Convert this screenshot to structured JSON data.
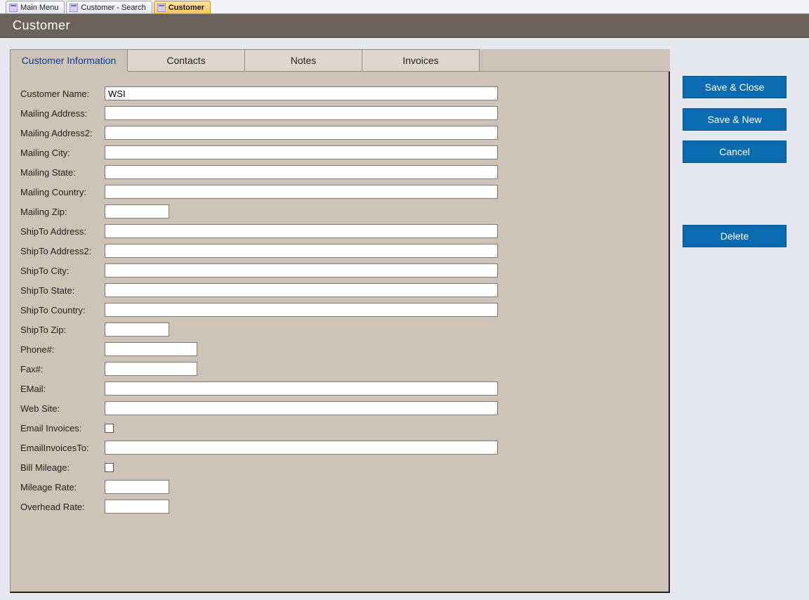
{
  "file_tabs": [
    {
      "label": "Main Menu",
      "active": false
    },
    {
      "label": "Customer - Search",
      "active": false
    },
    {
      "label": "Customer",
      "active": true
    }
  ],
  "header": {
    "title": "Customer"
  },
  "sub_tabs": [
    {
      "label": "Customer Information",
      "active": true
    },
    {
      "label": "Contacts",
      "active": false
    },
    {
      "label": "Notes",
      "active": false
    },
    {
      "label": "Invoices",
      "active": false
    }
  ],
  "form": {
    "customer_name": {
      "label": "Customer Name:",
      "value": "WSI"
    },
    "mailing_address": {
      "label": "Mailing Address:",
      "value": ""
    },
    "mailing_address2": {
      "label": "Mailing Address2:",
      "value": ""
    },
    "mailing_city": {
      "label": "Mailing City:",
      "value": ""
    },
    "mailing_state": {
      "label": "Mailing State:",
      "value": ""
    },
    "mailing_country": {
      "label": "Mailing Country:",
      "value": ""
    },
    "mailing_zip": {
      "label": "Mailing Zip:",
      "value": ""
    },
    "shipto_address": {
      "label": "ShipTo Address:",
      "value": ""
    },
    "shipto_address2": {
      "label": "ShipTo Address2:",
      "value": ""
    },
    "shipto_city": {
      "label": "ShipTo City:",
      "value": ""
    },
    "shipto_state": {
      "label": "ShipTo State:",
      "value": ""
    },
    "shipto_country": {
      "label": "ShipTo Country:",
      "value": ""
    },
    "shipto_zip": {
      "label": "ShipTo Zip:",
      "value": ""
    },
    "phone": {
      "label": "Phone#:",
      "value": ""
    },
    "fax": {
      "label": "Fax#:",
      "value": ""
    },
    "email": {
      "label": "EMail:",
      "value": ""
    },
    "website": {
      "label": "Web Site:",
      "value": ""
    },
    "email_invoices": {
      "label": "Email Invoices:",
      "checked": false
    },
    "email_invoices_to": {
      "label": "EmailInvoicesTo:",
      "value": ""
    },
    "bill_mileage": {
      "label": "Bill Mileage:",
      "checked": false
    },
    "mileage_rate": {
      "label": "Mileage Rate:",
      "value": ""
    },
    "overhead_rate": {
      "label": "Overhead Rate:",
      "value": ""
    }
  },
  "side_buttons": {
    "save_close": "Save & Close",
    "save_new": "Save & New",
    "cancel": "Cancel",
    "delete": "Delete"
  }
}
